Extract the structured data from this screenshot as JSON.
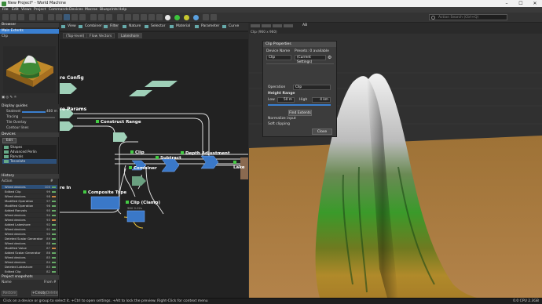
{
  "window": {
    "title": "New Project* - World Machine",
    "controls": [
      "–",
      "☐",
      "✕"
    ]
  },
  "menu": [
    "File",
    "Edit",
    "Views",
    "Project",
    "Commands",
    "Devices",
    "Macros",
    "Blueprints",
    "Help"
  ],
  "toolbar": {
    "search_placeholder": "Action Search (Ctrl+Q)"
  },
  "browser": {
    "title": "Browser",
    "extents_label": "Main Extents",
    "extents_sub": "Clip"
  },
  "display_guides": {
    "title": "Display guides",
    "sealevel_label": "Sealevel",
    "sealevel_value": "460 m",
    "tracing_label": "Tracing",
    "tile_overlay_label": "Tile Overlay",
    "contour_lines_label": "Contour lines"
  },
  "devices_panel": {
    "title": "Devices",
    "edit_label": "Edit",
    "items": [
      "Shapes",
      "Advanced Perlin",
      "Ranvals",
      "Tesselate"
    ]
  },
  "history": {
    "title": "History",
    "col_action": "Action",
    "col_num": "#",
    "rows": [
      {
        "action": "Wired devices",
        "num": "100",
        "color": "#6a6"
      },
      {
        "action": "Edited Clip",
        "num": "99",
        "color": "#6a6"
      },
      {
        "action": "Wired devices",
        "num": "98",
        "color": "#c84"
      },
      {
        "action": "Modified Operation",
        "num": "97",
        "color": "#6a6"
      },
      {
        "action": "Modified Operation",
        "num": "96",
        "color": "#6a6"
      },
      {
        "action": "Added Ranvals",
        "num": "95",
        "color": "#6a6"
      },
      {
        "action": "Wired devices",
        "num": "94",
        "color": "#6a6"
      },
      {
        "action": "Wired devices",
        "num": "93",
        "color": "#c84"
      },
      {
        "action": "Added Lakeshore",
        "num": "92",
        "color": "#6a6"
      },
      {
        "action": "Wired devices",
        "num": "91",
        "color": "#6a6"
      },
      {
        "action": "Wired devices",
        "num": "90",
        "color": "#6a6"
      },
      {
        "action": "Deleted Scalar Generator",
        "num": "89",
        "color": "#6a6"
      },
      {
        "action": "Wired devices",
        "num": "88",
        "color": "#6a6"
      },
      {
        "action": "Modified Value",
        "num": "87",
        "color": "#c84"
      },
      {
        "action": "Added Scalar Generator",
        "num": "86",
        "color": "#6a6"
      },
      {
        "action": "Wired devices",
        "num": "85",
        "color": "#6a6"
      },
      {
        "action": "Wired devices",
        "num": "84",
        "color": "#6a6"
      },
      {
        "action": "Deleted Lakeshore",
        "num": "83",
        "color": "#6a6"
      },
      {
        "action": "Edited Clip",
        "num": "82",
        "color": "#6a6"
      },
      {
        "action": "Wired devices",
        "num": "81",
        "color": "#c84"
      }
    ]
  },
  "snapshots": {
    "title": "Project snapshots",
    "col_name": "Name",
    "col_from": "From #",
    "buttons": [
      "Restore",
      "+Create",
      "Delete"
    ]
  },
  "graph_tabs": [
    "View",
    "Combiner",
    "Filter",
    "Nature",
    "Selector",
    "Material",
    "Parameter",
    "Curve"
  ],
  "breadcrumbs": [
    "(Top-level)",
    "Flow Vectors",
    "Lakeshore"
  ],
  "nodes": {
    "project_config": "re Config",
    "world_params": "re Params",
    "construct_range": "Construct Range",
    "clip": "Clip",
    "subtract": "Subtract",
    "depth_adjustment": "Depth Adjustment",
    "lake": "Lake",
    "combiner": "Combiner",
    "composite_type": "Composite Type",
    "clip_clamp": "Clip (Clamp)",
    "clip_clamp_timing": "960  0.02s",
    "bottom_left": "re In"
  },
  "viewport": {
    "tab_label": "Clip (960 x 960)",
    "tab_extra": "AB"
  },
  "dialog": {
    "title": "Clip Properties",
    "device_name_label": "Device Name",
    "device_name_value": "Clip",
    "presets_label": "Presets: 0 available",
    "presets_value": "(Current Settings)",
    "operation_label": "Operation",
    "operation_value": "Clip",
    "height_range_label": "Height Range",
    "low_label": "Low",
    "low_value": "50 m",
    "high_label": "High",
    "high_value": "4 km",
    "find_extents_label": "Find Extents",
    "normalize_label": "Normalize input",
    "soft_clipping_label": "Soft clipping",
    "close_label": "Close"
  },
  "status": {
    "message": "Click on a device or group to select it. +Ctrl to open settings. +Alt to lock the preview. Right-Click for context menu",
    "perf": "0.0 CPU  2.3GB"
  },
  "colors": {
    "accent": "#3a7fd0",
    "node_blue": "#3a78c8",
    "node_green": "#9fd0b8",
    "wire": "#d0d0d0",
    "selected_wire": "#e8c23a"
  }
}
